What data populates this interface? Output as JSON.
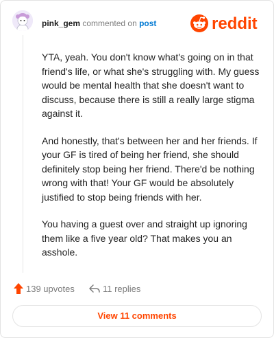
{
  "comment": {
    "username": "pink_gem",
    "action_text": "commented on",
    "target_text": "post",
    "paragraphs": [
      "YTA, yeah. You don't know what's going on in that friend's life, or what she's struggling with. My guess would be mental health that she doesn't want to discuss, because there is still a really large stigma against it.",
      "And honestly, that's between her and her friends. If your GF is tired of being her friend, she should definitely stop being her friend. There'd be nothing wrong with that! Your GF would be absolutely justified to stop being friends with her.",
      "You having a guest over and straight up ignoring them like a five year old? That makes you an asshole."
    ]
  },
  "actions": {
    "upvotes": "139 upvotes",
    "replies": "11 replies"
  },
  "view_comments_label": "View 11 comments",
  "branding": {
    "logo_text": "reddit",
    "accent_color": "#ff4500"
  },
  "icons": {
    "avatar": "avatar-icon",
    "upvote": "upvote-arrow-icon",
    "reply": "reply-arrow-icon",
    "logo": "reddit-snoo-icon"
  }
}
